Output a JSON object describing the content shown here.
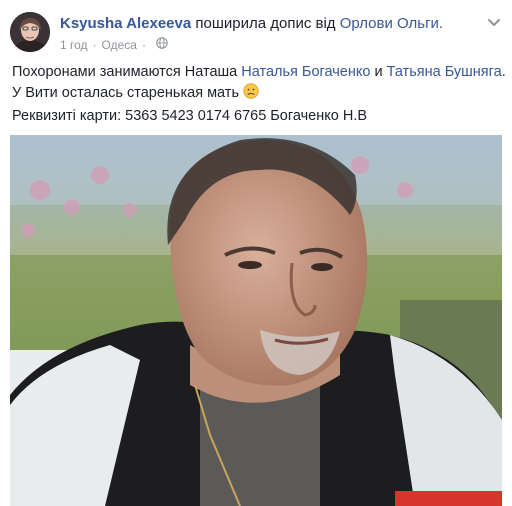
{
  "header": {
    "author": "Ksyusha Alexeeva",
    "shared_text": "поширила допис від",
    "shared_from": "Орлови Ольги.",
    "time": "1 год",
    "location": "Одеса"
  },
  "body": {
    "line1_prefix": "Похоронами занимаются Наташа ",
    "line1_link1": "Наталья Богаченко",
    "line1_and": " и ",
    "line1_link2": "Татьяна Бушняга",
    "line1_suffix": ".",
    "line2": "У Вити осталась старенькая мать",
    "line3": "Реквизиті карти: 5363 5423 0174 6765 Богаченко Н.В"
  },
  "icons": {
    "globe": "globe-icon",
    "chevron": "chevron-down-icon",
    "emoji": "sad-face-emoji-icon"
  },
  "colors": {
    "link": "#385898",
    "text": "#1d2129",
    "meta": "#90949c"
  }
}
